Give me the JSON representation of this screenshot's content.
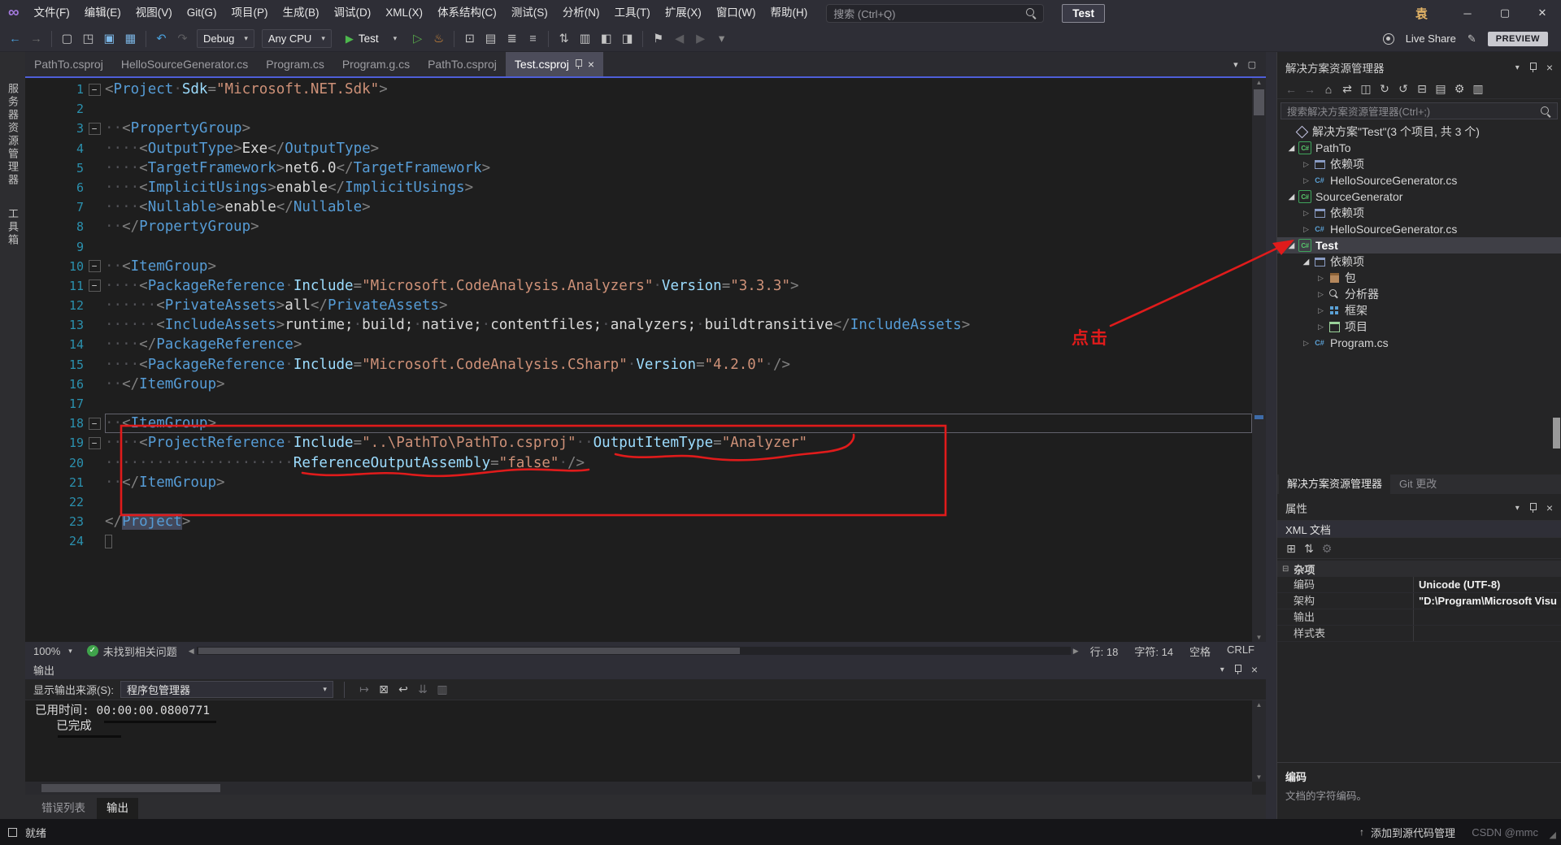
{
  "colors": {
    "annotation_red": "#e01b1b",
    "editor_bg": "#1e1e1e",
    "panel_bg": "#252526",
    "chrome_bg": "#2e2e36",
    "accent_tab_line": "#4e5ed8",
    "tag_blue": "#569cd6",
    "attr_blue": "#9cdcfe",
    "value_orange": "#ce9178",
    "line_number": "#2b91af"
  },
  "titlebar": {
    "menus": [
      "文件(F)",
      "编辑(E)",
      "视图(V)",
      "Git(G)",
      "项目(P)",
      "生成(B)",
      "调试(D)",
      "XML(X)",
      "体系结构(C)",
      "测试(S)",
      "分析(N)",
      "工具(T)",
      "扩展(X)",
      "窗口(W)",
      "帮助(H)"
    ],
    "search_placeholder": "搜索 (Ctrl+Q)",
    "startup_badge": "Test",
    "user_initial": "袁"
  },
  "toolbar": {
    "live_share": "Live Share",
    "preview_badge": "PREVIEW",
    "items": [
      {
        "k": "icon",
        "name": "nav-back-icon",
        "g": "←",
        "c": "#4aa3e0"
      },
      {
        "k": "icon",
        "name": "nav-forward-icon",
        "g": "→",
        "c": "#6e6e6e"
      },
      {
        "k": "sep"
      },
      {
        "k": "icon",
        "name": "new-file-icon",
        "g": "▢",
        "c": "#c5c5c5"
      },
      {
        "k": "icon",
        "name": "open-file-icon",
        "g": "◳",
        "c": "#c5c5c5"
      },
      {
        "k": "icon",
        "name": "save-icon",
        "g": "▣",
        "c": "#7db8e8"
      },
      {
        "k": "icon",
        "name": "save-all-icon",
        "g": "▦",
        "c": "#7db8e8"
      },
      {
        "k": "sep"
      },
      {
        "k": "icon",
        "name": "undo-icon",
        "g": "↶",
        "c": "#4aa3e0"
      },
      {
        "k": "icon",
        "name": "redo-icon",
        "g": "↷",
        "c": "#5c5c60"
      },
      {
        "k": "dd",
        "name": "solution-config-dropdown",
        "label": "Debug"
      },
      {
        "k": "dd",
        "name": "solution-platform-dropdown",
        "label": "Any CPU"
      },
      {
        "k": "run",
        "name": "start-debugging-button",
        "label": "Test"
      },
      {
        "k": "icon",
        "name": "start-without-debugging-icon",
        "g": "▷",
        "c": "#57a64a"
      },
      {
        "k": "icon",
        "name": "hot-reload-icon",
        "g": "♨",
        "c": "#d98d3b"
      },
      {
        "k": "sep"
      },
      {
        "k": "icon",
        "name": "break-all-icon",
        "g": "⊡",
        "c": "#c5c5c5"
      },
      {
        "k": "icon",
        "name": "diagnostics-icon",
        "g": "▤",
        "c": "#c5c5c5"
      },
      {
        "k": "icon",
        "name": "find-in-files-icon",
        "g": "≣",
        "c": "#c5c5c5"
      },
      {
        "k": "icon",
        "name": "document-outline-icon",
        "g": "≡",
        "c": "#c5c5c5"
      },
      {
        "k": "sep"
      },
      {
        "k": "icon",
        "name": "sort-lines-icon",
        "g": "⇅",
        "c": "#c5c5c5"
      },
      {
        "k": "icon",
        "name": "format-document-icon",
        "g": "▥",
        "c": "#c5c5c5"
      },
      {
        "k": "icon",
        "name": "comment-icon",
        "g": "◧",
        "c": "#c5c5c5"
      },
      {
        "k": "icon",
        "name": "uncomment-icon",
        "g": "◨",
        "c": "#c5c5c5"
      },
      {
        "k": "sep"
      },
      {
        "k": "icon",
        "name": "bookmark-icon",
        "g": "⚑",
        "c": "#c5c5c5"
      },
      {
        "k": "icon",
        "name": "prev-bookmark-icon",
        "g": "◀",
        "c": "#5c5c60"
      },
      {
        "k": "icon",
        "name": "next-bookmark-icon",
        "g": "▶",
        "c": "#5c5c60"
      },
      {
        "k": "icon",
        "name": "toolbar-overflow-icon",
        "g": "▾",
        "c": "#8a8a8a"
      }
    ]
  },
  "editor_tabs": [
    {
      "label": "PathTo.csproj"
    },
    {
      "label": "HelloSourceGenerator.cs"
    },
    {
      "label": "Program.cs"
    },
    {
      "label": "Program.g.cs"
    },
    {
      "label": "PathTo.csproj"
    },
    {
      "label": "Test.csproj",
      "active": true
    }
  ],
  "editor": {
    "current_line": 18,
    "lines": [
      {
        "n": 1,
        "f": true,
        "tk": [
          [
            "d",
            "<"
          ],
          [
            "t",
            "Project"
          ],
          [
            "w",
            "·"
          ],
          [
            "a",
            "Sdk"
          ],
          [
            "d",
            "="
          ],
          [
            "v",
            "\"Microsoft.NET.Sdk\""
          ],
          [
            "d",
            ">"
          ]
        ]
      },
      {
        "n": 2,
        "tk": []
      },
      {
        "n": 3,
        "f": true,
        "tk": [
          [
            "w",
            "··"
          ],
          [
            "d",
            "<"
          ],
          [
            "t",
            "PropertyGroup"
          ],
          [
            "d",
            ">"
          ]
        ]
      },
      {
        "n": 4,
        "tk": [
          [
            "w",
            "····"
          ],
          [
            "d",
            "<"
          ],
          [
            "t",
            "OutputType"
          ],
          [
            "d",
            ">"
          ],
          [
            "x",
            "Exe"
          ],
          [
            "d",
            "</"
          ],
          [
            "t",
            "OutputType"
          ],
          [
            "d",
            ">"
          ]
        ]
      },
      {
        "n": 5,
        "tk": [
          [
            "w",
            "····"
          ],
          [
            "d",
            "<"
          ],
          [
            "t",
            "TargetFramework"
          ],
          [
            "d",
            ">"
          ],
          [
            "x",
            "net6.0"
          ],
          [
            "d",
            "</"
          ],
          [
            "t",
            "TargetFramework"
          ],
          [
            "d",
            ">"
          ]
        ]
      },
      {
        "n": 6,
        "tk": [
          [
            "w",
            "····"
          ],
          [
            "d",
            "<"
          ],
          [
            "t",
            "ImplicitUsings"
          ],
          [
            "d",
            ">"
          ],
          [
            "x",
            "enable"
          ],
          [
            "d",
            "</"
          ],
          [
            "t",
            "ImplicitUsings"
          ],
          [
            "d",
            ">"
          ]
        ]
      },
      {
        "n": 7,
        "tk": [
          [
            "w",
            "····"
          ],
          [
            "d",
            "<"
          ],
          [
            "t",
            "Nullable"
          ],
          [
            "d",
            ">"
          ],
          [
            "x",
            "enable"
          ],
          [
            "d",
            "</"
          ],
          [
            "t",
            "Nullable"
          ],
          [
            "d",
            ">"
          ]
        ]
      },
      {
        "n": 8,
        "tk": [
          [
            "w",
            "··"
          ],
          [
            "d",
            "</"
          ],
          [
            "t",
            "PropertyGroup"
          ],
          [
            "d",
            ">"
          ]
        ]
      },
      {
        "n": 9,
        "tk": []
      },
      {
        "n": 10,
        "f": true,
        "tk": [
          [
            "w",
            "··"
          ],
          [
            "d",
            "<"
          ],
          [
            "t",
            "ItemGroup"
          ],
          [
            "d",
            ">"
          ]
        ]
      },
      {
        "n": 11,
        "f": true,
        "tk": [
          [
            "w",
            "····"
          ],
          [
            "d",
            "<"
          ],
          [
            "t",
            "PackageReference"
          ],
          [
            "w",
            "·"
          ],
          [
            "a",
            "Include"
          ],
          [
            "d",
            "="
          ],
          [
            "v",
            "\"Microsoft.CodeAnalysis.Analyzers\""
          ],
          [
            "w",
            "·"
          ],
          [
            "a",
            "Version"
          ],
          [
            "d",
            "="
          ],
          [
            "v",
            "\"3.3.3\""
          ],
          [
            "d",
            ">"
          ]
        ]
      },
      {
        "n": 12,
        "tk": [
          [
            "w",
            "······"
          ],
          [
            "d",
            "<"
          ],
          [
            "t",
            "PrivateAssets"
          ],
          [
            "d",
            ">"
          ],
          [
            "x",
            "all"
          ],
          [
            "d",
            "</"
          ],
          [
            "t",
            "PrivateAssets"
          ],
          [
            "d",
            ">"
          ]
        ]
      },
      {
        "n": 13,
        "tk": [
          [
            "w",
            "······"
          ],
          [
            "d",
            "<"
          ],
          [
            "t",
            "IncludeAssets"
          ],
          [
            "d",
            ">"
          ],
          [
            "x",
            "runtime;"
          ],
          [
            "w",
            "·"
          ],
          [
            "x",
            "build;"
          ],
          [
            "w",
            "·"
          ],
          [
            "x",
            "native;"
          ],
          [
            "w",
            "·"
          ],
          [
            "x",
            "contentfiles;"
          ],
          [
            "w",
            "·"
          ],
          [
            "x",
            "analyzers;"
          ],
          [
            "w",
            "·"
          ],
          [
            "x",
            "buildtransitive"
          ],
          [
            "d",
            "</"
          ],
          [
            "t",
            "IncludeAssets"
          ],
          [
            "d",
            ">"
          ]
        ]
      },
      {
        "n": 14,
        "tk": [
          [
            "w",
            "····"
          ],
          [
            "d",
            "</"
          ],
          [
            "t",
            "PackageReference"
          ],
          [
            "d",
            ">"
          ]
        ]
      },
      {
        "n": 15,
        "tk": [
          [
            "w",
            "····"
          ],
          [
            "d",
            "<"
          ],
          [
            "t",
            "PackageReference"
          ],
          [
            "w",
            "·"
          ],
          [
            "a",
            "Include"
          ],
          [
            "d",
            "="
          ],
          [
            "v",
            "\"Microsoft.CodeAnalysis.CSharp\""
          ],
          [
            "w",
            "·"
          ],
          [
            "a",
            "Version"
          ],
          [
            "d",
            "="
          ],
          [
            "v",
            "\"4.2.0\""
          ],
          [
            "w",
            "·"
          ],
          [
            "d",
            "/>"
          ]
        ]
      },
      {
        "n": 16,
        "tk": [
          [
            "w",
            "··"
          ],
          [
            "d",
            "</"
          ],
          [
            "t",
            "ItemGroup"
          ],
          [
            "d",
            ">"
          ]
        ]
      },
      {
        "n": 17,
        "tk": []
      },
      {
        "n": 18,
        "f": true,
        "tk": [
          [
            "w",
            "··"
          ],
          [
            "d",
            "<"
          ],
          [
            "t",
            "ItemGroup"
          ],
          [
            "d",
            ">"
          ]
        ]
      },
      {
        "n": 19,
        "f": true,
        "tk": [
          [
            "w",
            "····"
          ],
          [
            "d",
            "<"
          ],
          [
            "t",
            "ProjectReference"
          ],
          [
            "w",
            "·"
          ],
          [
            "a",
            "Include"
          ],
          [
            "d",
            "="
          ],
          [
            "v",
            "\"..\\PathTo\\PathTo.csproj\""
          ],
          [
            "w",
            "··"
          ],
          [
            "a",
            "OutputItemType"
          ],
          [
            "d",
            "="
          ],
          [
            "v",
            "\"Analyzer\""
          ]
        ]
      },
      {
        "n": 20,
        "tk": [
          [
            "w",
            "······················"
          ],
          [
            "a",
            "ReferenceOutputAssembly"
          ],
          [
            "d",
            "="
          ],
          [
            "v",
            "\"false\""
          ],
          [
            "w",
            "·"
          ],
          [
            "d",
            "/>"
          ]
        ]
      },
      {
        "n": 21,
        "tk": [
          [
            "w",
            "··"
          ],
          [
            "d",
            "</"
          ],
          [
            "t",
            "ItemGroup"
          ],
          [
            "d",
            ">"
          ]
        ]
      },
      {
        "n": 22,
        "tk": []
      },
      {
        "n": 23,
        "tk": [
          [
            "d",
            "</"
          ],
          [
            "h",
            "Project"
          ],
          [
            "d",
            ">"
          ]
        ]
      },
      {
        "n": 24,
        "box": true,
        "tk": []
      }
    ]
  },
  "annotations": {
    "click_label": "点击"
  },
  "editor_statusbar": {
    "zoom": "100%",
    "health": "未找到相关问题",
    "line": "行: 18",
    "column": "字符: 14",
    "spaces": "空格",
    "line_ending": "CRLF"
  },
  "output_panel": {
    "title": "输出",
    "source_label": "显示输出来源(S):",
    "source_value": "程序包管理器",
    "lines": [
      "已用时间: 00:00:00.0800771",
      "   已完成"
    ],
    "icons": [
      {
        "name": "out-jump-icon",
        "g": "↦",
        "c": "#6e6e73"
      },
      {
        "name": "out-clear-icon",
        "g": "⊠",
        "c": "#c5c5c5"
      },
      {
        "name": "out-wrap-icon",
        "g": "↩",
        "c": "#c5c5c5"
      },
      {
        "name": "out-autoscroll-icon",
        "g": "⇊",
        "c": "#6e6e73"
      },
      {
        "name": "out-pin-icon",
        "g": "▥",
        "c": "#6e6e73"
      }
    ]
  },
  "bottom_tabs": [
    {
      "label": "错误列表"
    },
    {
      "label": "输出",
      "active": true
    }
  ],
  "statusbar": {
    "ready": "就绪",
    "add_to_source_control": "添加到源代码管理",
    "watermark": "CSDN @mmc"
  },
  "left_strip": [
    "服务器资源管理器",
    "工具箱"
  ],
  "solution_explorer": {
    "title": "解决方案资源管理器",
    "search_placeholder": "搜索解决方案资源管理器(Ctrl+;)",
    "toolbar": [
      {
        "name": "se-back-icon",
        "g": "←",
        "c": "#66666c"
      },
      {
        "name": "se-forward-icon",
        "g": "→",
        "c": "#66666c"
      },
      {
        "name": "se-home-icon",
        "g": "⌂",
        "c": "#c5c5c5"
      },
      {
        "name": "se-switch-views-icon",
        "g": "⇄",
        "c": "#c5c5c5"
      },
      {
        "name": "se-pending-changes-icon",
        "g": "◫",
        "c": "#c5c5c5"
      },
      {
        "name": "se-sync-icon",
        "g": "↻",
        "c": "#c5c5c5"
      },
      {
        "name": "se-refresh-icon",
        "g": "↺",
        "c": "#c5c5c5"
      },
      {
        "name": "se-collapse-all-icon",
        "g": "⊟",
        "c": "#c5c5c5"
      },
      {
        "name": "se-show-all-files-icon",
        "g": "▤",
        "c": "#c5c5c5"
      },
      {
        "name": "se-properties-icon",
        "g": "⚙",
        "c": "#c5c5c5"
      },
      {
        "name": "se-preview-icon",
        "g": "▥",
        "c": "#c5c5c5"
      }
    ],
    "tree": [
      {
        "label": "解决方案\"Test\"(3 个项目, 共 3 个)",
        "icon": "solution",
        "level": 0,
        "exp": "none"
      },
      {
        "label": "PathTo",
        "icon": "csproj",
        "level": 1,
        "exp": "expanded"
      },
      {
        "label": "依赖项",
        "icon": "deps",
        "level": 2,
        "exp": "collapsed"
      },
      {
        "label": "HelloSourceGenerator.cs",
        "icon": "csfile",
        "level": 2,
        "exp": "collapsed"
      },
      {
        "label": "SourceGenerator",
        "icon": "csproj",
        "level": 1,
        "exp": "expanded"
      },
      {
        "label": "依赖项",
        "icon": "deps",
        "level": 2,
        "exp": "collapsed"
      },
      {
        "label": "HelloSourceGenerator.cs",
        "icon": "csfile",
        "level": 2,
        "exp": "collapsed"
      },
      {
        "label": "Test",
        "icon": "csproj",
        "level": 1,
        "exp": "expanded",
        "selected": true,
        "bold": true
      },
      {
        "label": "依赖项",
        "icon": "deps",
        "level": 2,
        "exp": "expanded"
      },
      {
        "label": "包",
        "icon": "package",
        "level": 3,
        "exp": "collapsed"
      },
      {
        "label": "分析器",
        "icon": "analyzer",
        "level": 3,
        "exp": "collapsed"
      },
      {
        "label": "框架",
        "icon": "framework",
        "level": 3,
        "exp": "collapsed"
      },
      {
        "label": "项目",
        "icon": "project",
        "level": 3,
        "exp": "collapsed"
      },
      {
        "label": "Program.cs",
        "icon": "csfile",
        "level": 2,
        "exp": "collapsed"
      }
    ],
    "panel_tabs": [
      {
        "label": "解决方案资源管理器",
        "active": true
      },
      {
        "label": "Git 更改"
      }
    ]
  },
  "properties_panel": {
    "title": "属性",
    "object_name": "XML 文档",
    "category": "杂项",
    "toolbar": [
      {
        "name": "props-categorized-icon",
        "g": "⊞",
        "c": "#c5c5c5"
      },
      {
        "name": "props-alphabetical-icon",
        "g": "⇅",
        "c": "#c5c5c5"
      },
      {
        "name": "props-pages-icon",
        "g": "⚙",
        "c": "#6e6e73"
      }
    ],
    "rows": [
      {
        "label": "编码",
        "value": "Unicode (UTF-8)"
      },
      {
        "label": "架构",
        "value": "\"D:\\Program\\Microsoft Visu"
      },
      {
        "label": "输出",
        "value": ""
      },
      {
        "label": "样式表",
        "value": ""
      }
    ],
    "description_title": "编码",
    "description_text": "文档的字符编码。"
  }
}
